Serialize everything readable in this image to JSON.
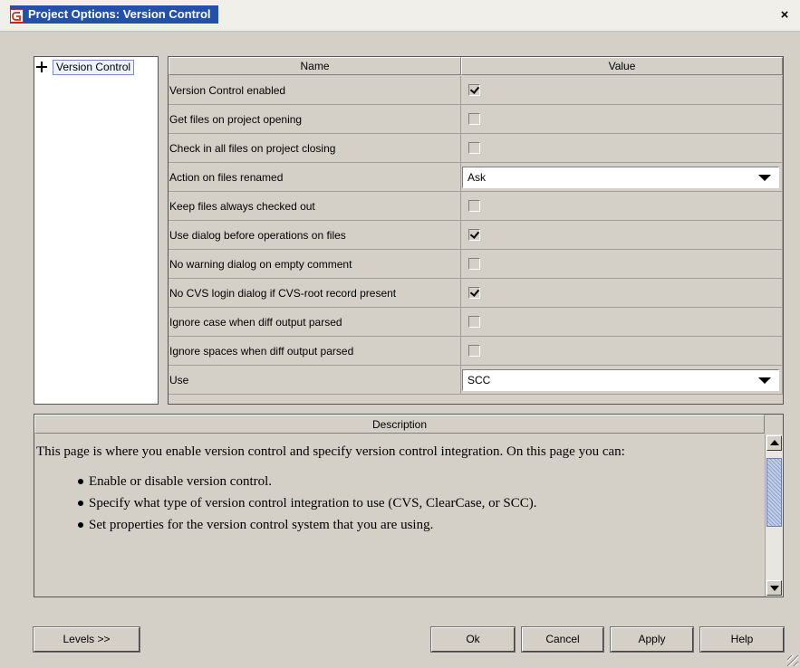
{
  "window": {
    "title": "Project Options: Version Control",
    "close_label": "×"
  },
  "tree": {
    "root_label": "Version Control"
  },
  "properties": {
    "header_name": "Name",
    "header_value": "Value",
    "rows": [
      {
        "name": "Version Control enabled",
        "type": "checkbox",
        "checked": true
      },
      {
        "name": "Get files on project opening",
        "type": "checkbox",
        "checked": false
      },
      {
        "name": "Check in all files on project closing",
        "type": "checkbox",
        "checked": false
      },
      {
        "name": "Action on files renamed",
        "type": "combo",
        "value": "Ask"
      },
      {
        "name": "Keep files always checked out",
        "type": "checkbox",
        "checked": false
      },
      {
        "name": "Use dialog before operations on files",
        "type": "checkbox",
        "checked": true
      },
      {
        "name": "No warning dialog on empty comment",
        "type": "checkbox",
        "checked": false
      },
      {
        "name": "No CVS login dialog if CVS-root record present",
        "type": "checkbox",
        "checked": true
      },
      {
        "name": "Ignore case when diff output parsed",
        "type": "checkbox",
        "checked": false
      },
      {
        "name": "Ignore spaces when diff output parsed",
        "type": "checkbox",
        "checked": false
      },
      {
        "name": "Use",
        "type": "combo",
        "value": "SCC"
      }
    ]
  },
  "description": {
    "header": "Description",
    "intro": "This page is where you enable version control and specify version control integration. On this page you can:",
    "bullets": [
      "Enable or disable version control.",
      "Specify what type of version control integration to use (CVS, ClearCase, or SCC).",
      "Set properties for the version control system that you are using."
    ]
  },
  "buttons": {
    "levels": "Levels >>",
    "ok": "Ok",
    "cancel": "Cancel",
    "apply": "Apply",
    "help": "Help"
  },
  "colors": {
    "dialog_bg": "#d4d0c8",
    "title_bg": "#2450a8",
    "title_fg": "#ffffff"
  }
}
